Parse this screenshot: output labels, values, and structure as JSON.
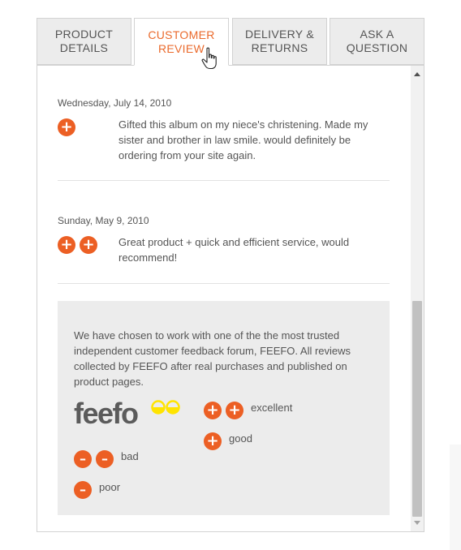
{
  "tabs": [
    {
      "label": "PRODUCT\nDETAILS",
      "active": false
    },
    {
      "label": "CUSTOMER\nREVIEW",
      "active": true
    },
    {
      "label": "DELIVERY &\nRETURNS",
      "active": false
    },
    {
      "label": "ASK A\nQUESTION",
      "active": false
    }
  ],
  "reviews": [
    {
      "date": "Wednesday, July 14, 2010",
      "rating_symbols": [
        "+"
      ],
      "text": "Gifted this album on my niece's christening. Made my sister and brother in law smile. would definitely be ordering from your site again."
    },
    {
      "date": "Sunday, May 9, 2010",
      "rating_symbols": [
        "+",
        "+"
      ],
      "text": "Great product + quick and efficient service, would recommend!"
    }
  ],
  "info": {
    "text": "We have chosen to work with one of the the most trusted independent customer feedback forum, FEEFO. All reviews collected by FEEFO after real purchases and published on product pages.",
    "logo_text": "feefo",
    "legend": [
      {
        "symbols": [
          "+",
          "+"
        ],
        "label": "excellent"
      },
      {
        "symbols": [
          "+"
        ],
        "label": "good"
      },
      {
        "symbols": [
          "–",
          "–"
        ],
        "label": "bad"
      },
      {
        "symbols": [
          "–"
        ],
        "label": "poor"
      }
    ]
  },
  "colors": {
    "accent": "#ec5f24",
    "active_tab_text": "#ea6a2c",
    "feefo_gray": "#5b5b5b",
    "feefo_yellow": "#ffe400"
  },
  "scrollbar": {
    "position_fraction": 0.5
  }
}
